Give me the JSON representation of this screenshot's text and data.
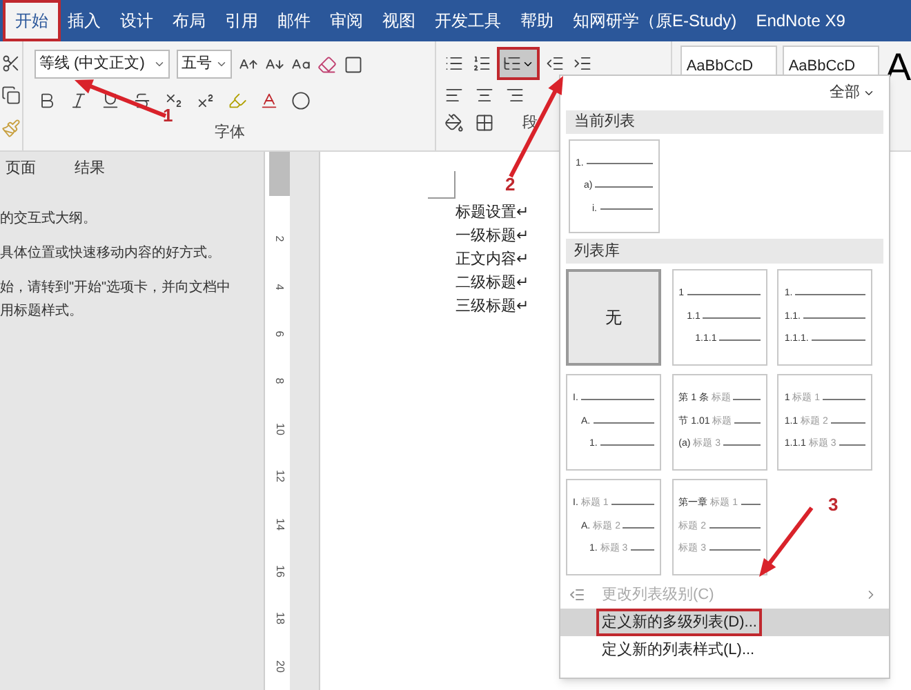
{
  "tabs": [
    {
      "label": "开始",
      "selected": true,
      "annotated": true
    },
    {
      "label": "插入",
      "selected": false,
      "annotated": false
    },
    {
      "label": "设计",
      "selected": false,
      "annotated": false
    },
    {
      "label": "布局",
      "selected": false,
      "annotated": false
    },
    {
      "label": "引用",
      "selected": false,
      "annotated": false
    },
    {
      "label": "邮件",
      "selected": false,
      "annotated": false
    },
    {
      "label": "审阅",
      "selected": false,
      "annotated": false
    },
    {
      "label": "视图",
      "selected": false,
      "annotated": false
    },
    {
      "label": "开发工具",
      "selected": false,
      "annotated": false
    },
    {
      "label": "帮助",
      "selected": false,
      "annotated": false
    },
    {
      "label": "知网研学（原E-Study)",
      "selected": false,
      "annotated": false
    },
    {
      "label": "EndNote X9",
      "selected": false,
      "annotated": false
    }
  ],
  "ribbon": {
    "font_name": "等线 (中文正文)",
    "font_size": "五号",
    "font_group_label": "字体",
    "paragraph_group_label": "段",
    "multilevel_list_annotated": true,
    "style_previews": [
      "AaBbCcD",
      "AaBbCcD"
    ],
    "style_big": "A"
  },
  "navigation": {
    "tabs": [
      "页面",
      "结果"
    ],
    "lines": [
      "的交互式大纲。",
      "具体位置或快速移动内容的好方式。",
      "始，请转到\"开始\"选项卡，并向文档中",
      "用标题样式。"
    ]
  },
  "ruler": {
    "marks": [
      "2",
      "4",
      "6",
      "8",
      "10",
      "12",
      "14",
      "16",
      "18",
      "20"
    ]
  },
  "document": {
    "lines": [
      "标题设置↵",
      "一级标题↵",
      "正文内容↵",
      "二级标题↵",
      "三级标题↵"
    ]
  },
  "list_menu": {
    "filter": "全部",
    "current_title": "当前列表",
    "current": [
      {
        "kind": "stepped",
        "selected": false,
        "lines": [
          {
            "number": "1."
          },
          {
            "number": "a)"
          },
          {
            "number": "i."
          }
        ]
      }
    ],
    "library_title": "列表库",
    "library": [
      {
        "kind": "none",
        "selected": true,
        "text": "无"
      },
      {
        "kind": "stepped",
        "selected": false,
        "lines": [
          {
            "number": "1"
          },
          {
            "number": "1.1"
          },
          {
            "number": "1.1.1"
          }
        ]
      },
      {
        "kind": "flush",
        "selected": false,
        "lines": [
          {
            "number": "1."
          },
          {
            "number": "1.1."
          },
          {
            "number": "1.1.1."
          }
        ]
      },
      {
        "kind": "stepped",
        "selected": false,
        "lines": [
          {
            "number": "I."
          },
          {
            "number": "A."
          },
          {
            "number": "1."
          }
        ]
      },
      {
        "kind": "flush",
        "selected": false,
        "lines": [
          {
            "number": "第 1 条",
            "label": "标题"
          },
          {
            "number": "节 1.01",
            "label": "标题"
          },
          {
            "number": "(a)",
            "label": "标题 3"
          }
        ]
      },
      {
        "kind": "flush",
        "selected": false,
        "lines": [
          {
            "number": "1",
            "label": "标题 1"
          },
          {
            "number": "1.1",
            "label": "标题 2"
          },
          {
            "number": "1.1.1",
            "label": "标题 3"
          }
        ]
      },
      {
        "kind": "stepped",
        "selected": false,
        "lines": [
          {
            "number": "I.",
            "label": "标题 1"
          },
          {
            "number": "A.",
            "label": "标题 2"
          },
          {
            "number": "1.",
            "label": "标题 3"
          }
        ]
      },
      {
        "kind": "flush",
        "selected": false,
        "lines": [
          {
            "number": "第一章",
            "label": "标题 1"
          },
          {
            "label": "标题 2"
          },
          {
            "label": "标题 3"
          }
        ]
      }
    ],
    "items": [
      {
        "label": "更改列表级别(C)",
        "disabled": true,
        "submenu": true,
        "selected": false,
        "annotated": false
      },
      {
        "label": "定义新的多级列表(D)...",
        "disabled": false,
        "submenu": false,
        "selected": true,
        "annotated": true
      },
      {
        "label": "定义新的列表样式(L)...",
        "disabled": false,
        "submenu": false,
        "selected": false,
        "annotated": false
      }
    ]
  },
  "annotations": [
    {
      "label": "1"
    },
    {
      "label": "2"
    },
    {
      "label": "3"
    }
  ]
}
